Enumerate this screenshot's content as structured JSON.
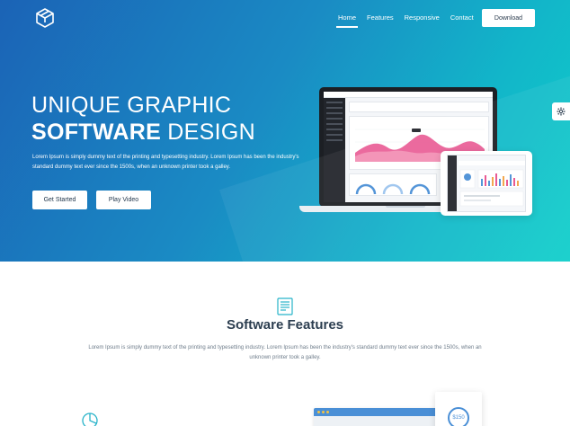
{
  "nav": {
    "links": [
      "Home",
      "Features",
      "Responsive",
      "Contact"
    ],
    "active": "Home",
    "download_label": "Download"
  },
  "hero": {
    "title_line1": "UNIQUE GRAPHIC",
    "title_bold": "SOFTWARE",
    "title_light": " DESIGN",
    "description": "Lorem Ipsum is simply dummy text of the printing and typesetting industry. Lorem Ipsum has been the industry's standard dummy text ever since the 1500s, when an unknown printer took a galley.",
    "get_started_label": "Get Started",
    "play_video_label": "Play Video"
  },
  "features": {
    "title": "Software Features",
    "description": "Lorem Ipsum is simply dummy text of the printing and typesetting industry. Lorem Ipsum has been the industry's standard dummy text ever since the 1500s, when an unknown printer took a galley.",
    "price": "$150"
  },
  "icons": {
    "logo": "cube-logo-icon",
    "settings": "gear-icon",
    "features": "document-list-icon",
    "analytics": "pie-chart-icon"
  },
  "colors": {
    "hero_start": "#1b63b6",
    "hero_end": "#0fcfca",
    "heading": "#2c3e50",
    "body_text": "#6f7d8b",
    "accent": "#4a8fd6"
  }
}
